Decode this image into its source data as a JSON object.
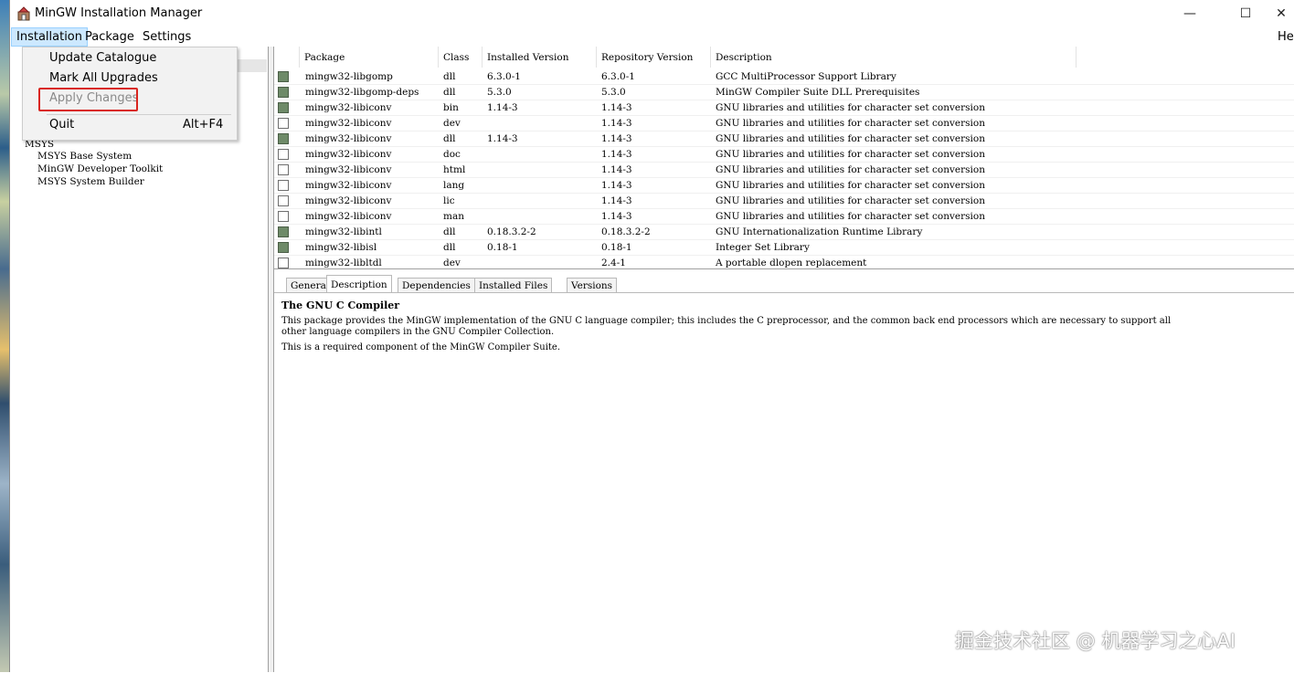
{
  "window": {
    "title": "MinGW Installation Manager",
    "min_glyph": "—",
    "max_glyph": "☐",
    "close_glyph": "✕"
  },
  "menubar": {
    "installation": "Installation",
    "package": "Package",
    "settings": "Settings",
    "help": "Hel"
  },
  "dropdown": {
    "update_catalogue": "Update Catalogue",
    "mark_all_upgrades": "Mark All Upgrades",
    "apply_changes": "Apply Changes",
    "quit": "Quit",
    "quit_shortcut": "Alt+F4"
  },
  "tree": {
    "msys": "MSYS",
    "msys_base": "MSYS Base System",
    "mingw_dev_toolkit": "MinGW Developer Toolkit",
    "msys_system_builder": "MSYS System Builder"
  },
  "table": {
    "headers": [
      "Package",
      "Class",
      "Installed Version",
      "Repository Version",
      "Description"
    ],
    "rows": [
      {
        "checked": true,
        "package": "mingw32-libgomp",
        "class": "dll",
        "installed": "6.3.0-1",
        "repository": "6.3.0-1",
        "description": "GCC MultiProcessor Support Library"
      },
      {
        "checked": true,
        "package": "mingw32-libgomp-deps",
        "class": "dll",
        "installed": "5.3.0",
        "repository": "5.3.0",
        "description": "MinGW Compiler Suite DLL Prerequisites"
      },
      {
        "checked": true,
        "package": "mingw32-libiconv",
        "class": "bin",
        "installed": "1.14-3",
        "repository": "1.14-3",
        "description": "GNU libraries and utilities for character set conversion"
      },
      {
        "checked": false,
        "package": "mingw32-libiconv",
        "class": "dev",
        "installed": "",
        "repository": "1.14-3",
        "description": "GNU libraries and utilities for character set conversion"
      },
      {
        "checked": true,
        "package": "mingw32-libiconv",
        "class": "dll",
        "installed": "1.14-3",
        "repository": "1.14-3",
        "description": "GNU libraries and utilities for character set conversion"
      },
      {
        "checked": false,
        "package": "mingw32-libiconv",
        "class": "doc",
        "installed": "",
        "repository": "1.14-3",
        "description": "GNU libraries and utilities for character set conversion"
      },
      {
        "checked": false,
        "package": "mingw32-libiconv",
        "class": "html",
        "installed": "",
        "repository": "1.14-3",
        "description": "GNU libraries and utilities for character set conversion"
      },
      {
        "checked": false,
        "package": "mingw32-libiconv",
        "class": "lang",
        "installed": "",
        "repository": "1.14-3",
        "description": "GNU libraries and utilities for character set conversion"
      },
      {
        "checked": false,
        "package": "mingw32-libiconv",
        "class": "lic",
        "installed": "",
        "repository": "1.14-3",
        "description": "GNU libraries and utilities for character set conversion"
      },
      {
        "checked": false,
        "package": "mingw32-libiconv",
        "class": "man",
        "installed": "",
        "repository": "1.14-3",
        "description": "GNU libraries and utilities for character set conversion"
      },
      {
        "checked": true,
        "package": "mingw32-libintl",
        "class": "dll",
        "installed": "0.18.3.2-2",
        "repository": "0.18.3.2-2",
        "description": "GNU Internationalization Runtime Library"
      },
      {
        "checked": true,
        "package": "mingw32-libisl",
        "class": "dll",
        "installed": "0.18-1",
        "repository": "0.18-1",
        "description": "Integer Set Library"
      },
      {
        "checked": false,
        "package": "mingw32-libltdl",
        "class": "dev",
        "installed": "",
        "repository": "2.4-1",
        "description": "A portable dlopen replacement"
      }
    ]
  },
  "tabs": {
    "general": "General",
    "description": "Description",
    "dependencies": "Dependencies",
    "installed_files": "Installed Files",
    "versions": "Versions"
  },
  "details": {
    "title": "The GNU C Compiler",
    "line1": "This package provides the MinGW implementation of the GNU C language compiler; this includes the C preprocessor, and the common back end processors which are necessary to support all",
    "line2": "other language compilers in the GNU Compiler Collection.",
    "line3": "This is a required component of the MinGW Compiler Suite."
  },
  "watermark": "掘金技术社区 @ 机器学习之心AI",
  "colors": {
    "checked_box": "#6e8a68",
    "menu_highlight": "#cce8ff",
    "annotation_box": "#d9251f"
  }
}
